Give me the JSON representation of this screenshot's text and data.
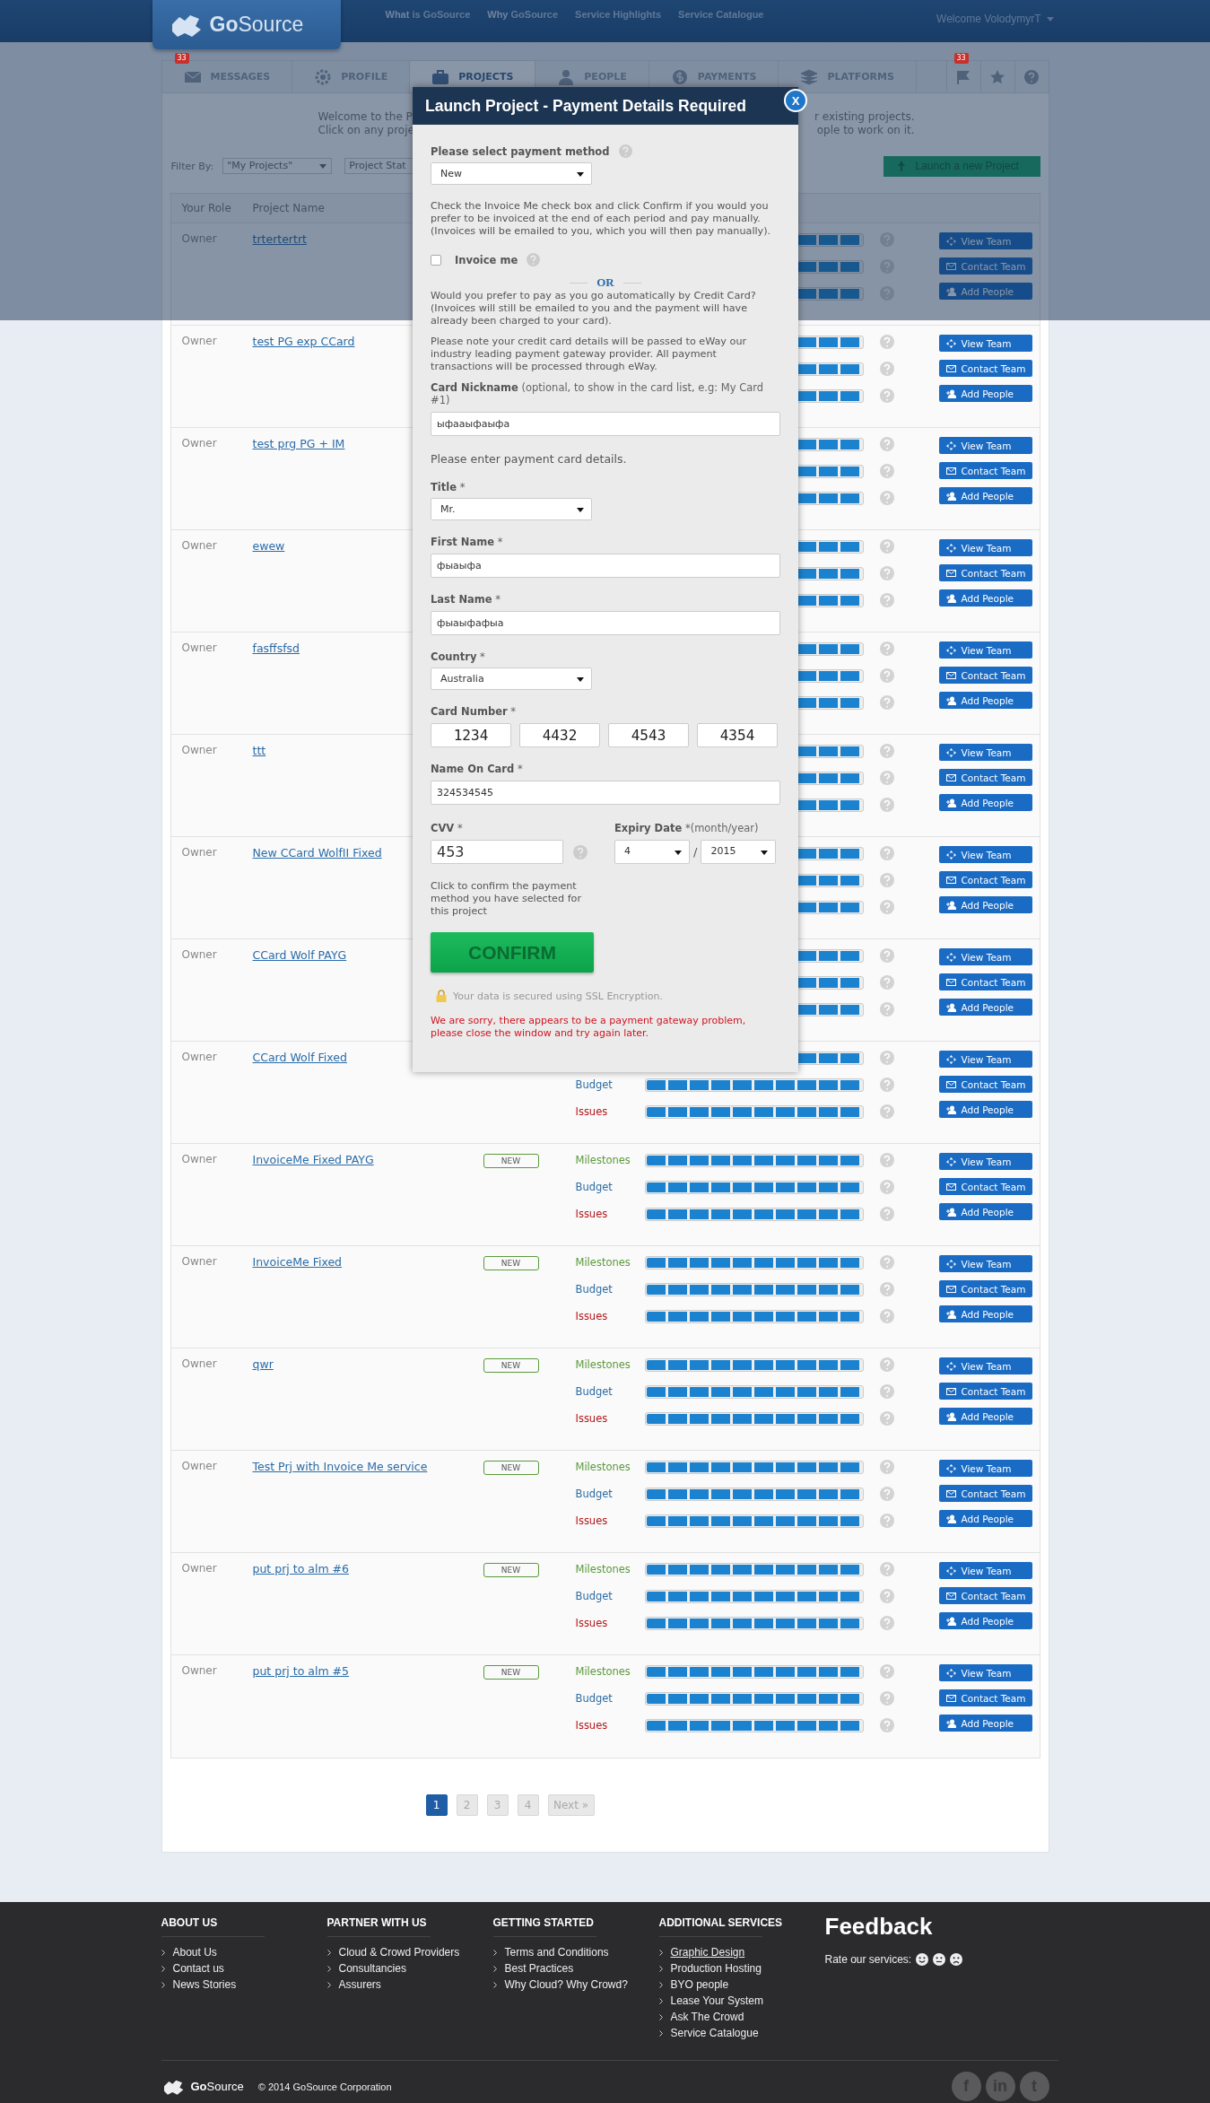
{
  "header": {
    "logo": "**Go**Source",
    "nav": [
      "**What** is GoSource",
      "**Why** GoSource",
      "Service Highlights",
      "Service Catalogue"
    ],
    "user": "Welcome VolodymyrT"
  },
  "tabs": [
    {
      "label": "MESSAGES",
      "kind": "envelope",
      "badge": "33",
      "selected": false
    },
    {
      "label": "PROFILE",
      "kind": "gear",
      "selected": false
    },
    {
      "label": "PROJECTS",
      "kind": "briefcase",
      "selected": true
    },
    {
      "label": "PEOPLE",
      "kind": "person",
      "selected": false
    },
    {
      "label": "PAYMENTS",
      "kind": "coin",
      "selected": false
    },
    {
      "label": "PLATFORMS",
      "kind": "stack",
      "selected": false
    }
  ],
  "tab_icons": [
    {
      "kind": "flag",
      "badge": "33"
    },
    {
      "kind": "star"
    },
    {
      "kind": "help"
    }
  ],
  "intro": {
    "left": [
      "Welcome to the P",
      "Click on any proje"
    ],
    "right": [
      "r existing projects.",
      "ople to work on it."
    ]
  },
  "filter": {
    "label": "Filter By:",
    "selects": [
      "\"My Projects\"",
      "Project Stat"
    ],
    "launch_button": "Launch a new Project"
  },
  "table": {
    "columns": [
      "Your Role",
      "Project Name"
    ],
    "rows": [
      {
        "role": "Owner",
        "name": "trtertertrt",
        "metrics": [
          {
            "kind": "milestones",
            "level": 1
          },
          {
            "kind": "budget",
            "level": 1
          },
          {
            "kind": "issues",
            "level": 1
          }
        ],
        "buttons": [
          {
            "kind": "view",
            "label": "View Team"
          },
          {
            "kind": "contact",
            "label": "Contact Team"
          },
          {
            "kind": "add",
            "label": "Add People"
          }
        ]
      },
      {
        "role": "Owner",
        "name": "test PG exp CCard",
        "metrics": [
          {
            "kind": "milestones",
            "level": 1
          },
          {
            "kind": "budget",
            "level": 1
          },
          {
            "kind": "issues",
            "level": 1
          }
        ],
        "buttons": [
          {
            "kind": "view",
            "label": "View Team"
          },
          {
            "kind": "contact",
            "label": "Contact Team"
          },
          {
            "kind": "add",
            "label": "Add People"
          }
        ]
      },
      {
        "role": "Owner",
        "name": "test prg PG + IM",
        "metrics": [
          {
            "kind": "milestones",
            "level": 1
          },
          {
            "kind": "budget",
            "level": 1
          },
          {
            "kind": "issues",
            "level": 1
          }
        ],
        "buttons": [
          {
            "kind": "view",
            "label": "View Team"
          },
          {
            "kind": "contact",
            "label": "Contact Team"
          },
          {
            "kind": "add",
            "label": "Add People"
          }
        ]
      },
      {
        "role": "Owner",
        "name": "ewew",
        "metrics": [
          {
            "kind": "milestones",
            "level": 1
          },
          {
            "kind": "budget",
            "level": 1
          },
          {
            "kind": "issues",
            "level": 1
          }
        ],
        "buttons": [
          {
            "kind": "view",
            "label": "View Team"
          },
          {
            "kind": "contact",
            "label": "Contact Team"
          },
          {
            "kind": "add",
            "label": "Add People"
          }
        ]
      },
      {
        "role": "Owner",
        "name": "fasffsfsd",
        "metrics": [
          {
            "kind": "milestones",
            "level": 1
          },
          {
            "kind": "budget",
            "level": 1
          },
          {
            "kind": "issues",
            "level": 1
          }
        ],
        "buttons": [
          {
            "kind": "view",
            "label": "View Team"
          },
          {
            "kind": "contact",
            "label": "Contact Team"
          },
          {
            "kind": "add",
            "label": "Add People"
          }
        ]
      },
      {
        "role": "Owner",
        "name": "ttt",
        "metrics": [
          {
            "kind": "milestones",
            "level": 1
          },
          {
            "kind": "budget",
            "level": 1
          },
          {
            "kind": "issues",
            "level": 1
          }
        ],
        "buttons": [
          {
            "kind": "view",
            "label": "View Team"
          },
          {
            "kind": "contact",
            "label": "Contact Team"
          },
          {
            "kind": "add",
            "label": "Add People"
          }
        ]
      },
      {
        "role": "Owner",
        "name": "New CCard WolfII Fixed",
        "metrics": [
          {
            "kind": "milestones",
            "level": 1
          },
          {
            "kind": "budget",
            "level": 1
          },
          {
            "kind": "issues",
            "level": 1
          }
        ],
        "buttons": [
          {
            "kind": "view",
            "label": "View Team"
          },
          {
            "kind": "contact",
            "label": "Contact Team"
          },
          {
            "kind": "add",
            "label": "Add People"
          }
        ]
      },
      {
        "role": "Owner",
        "name": "CCard Wolf PAYG",
        "metrics": [
          {
            "kind": "milestones",
            "level": 1
          },
          {
            "kind": "budget",
            "level": 1
          },
          {
            "kind": "issues",
            "level": 1
          }
        ],
        "buttons": [
          {
            "kind": "view",
            "label": "View Team"
          },
          {
            "kind": "contact",
            "label": "Contact Team"
          },
          {
            "kind": "add",
            "label": "Add People"
          }
        ]
      },
      {
        "role": "Owner",
        "name": "CCard Wolf Fixed",
        "metrics": [
          {
            "kind": "milestones",
            "level": 1
          },
          {
            "kind": "budget",
            "label": "Budget",
            "level": 1
          },
          {
            "kind": "issues",
            "label": "Issues",
            "level": 1
          }
        ],
        "buttons": [
          {
            "kind": "view",
            "label": "View Team"
          },
          {
            "kind": "contact",
            "label": "Contact Team"
          },
          {
            "kind": "add",
            "label": "Add People"
          }
        ]
      },
      {
        "role": "Owner",
        "name": "InvoiceMe Fixed PAYG",
        "badge": "NEW",
        "metrics": [
          {
            "kind": "milestones",
            "label": "Milestones",
            "level": 1
          },
          {
            "kind": "budget",
            "label": "Budget",
            "level": 1
          },
          {
            "kind": "issues",
            "label": "Issues",
            "level": 1
          }
        ],
        "buttons": [
          {
            "kind": "view",
            "label": "View Team"
          },
          {
            "kind": "contact",
            "label": "Contact Team"
          },
          {
            "kind": "add",
            "label": "Add People"
          }
        ]
      },
      {
        "role": "Owner",
        "name": "InvoiceMe Fixed",
        "badge": "NEW",
        "metrics": [
          {
            "kind": "milestones",
            "label": "Milestones",
            "level": 1
          },
          {
            "kind": "budget",
            "label": "Budget",
            "level": 1
          },
          {
            "kind": "issues",
            "label": "Issues",
            "level": 1
          }
        ],
        "buttons": [
          {
            "kind": "view",
            "label": "View Team"
          },
          {
            "kind": "contact",
            "label": "Contact Team"
          },
          {
            "kind": "add",
            "label": "Add People"
          }
        ]
      },
      {
        "role": "Owner",
        "name": "qwr",
        "badge": "NEW",
        "metrics": [
          {
            "kind": "milestones",
            "label": "Milestones",
            "level": 1
          },
          {
            "kind": "budget",
            "label": "Budget",
            "level": 1
          },
          {
            "kind": "issues",
            "label": "Issues",
            "level": 1
          }
        ],
        "buttons": [
          {
            "kind": "view",
            "label": "View Team"
          },
          {
            "kind": "contact",
            "label": "Contact Team"
          },
          {
            "kind": "add",
            "label": "Add People"
          }
        ]
      },
      {
        "role": "Owner",
        "name": "Test Prj with Invoice Me service",
        "badge": "NEW",
        "metrics": [
          {
            "kind": "milestones",
            "label": "Milestones",
            "level": 1
          },
          {
            "kind": "budget",
            "label": "Budget",
            "level": 1
          },
          {
            "kind": "issues",
            "label": "Issues",
            "level": 1
          }
        ],
        "buttons": [
          {
            "kind": "view",
            "label": "View Team"
          },
          {
            "kind": "contact",
            "label": "Contact Team"
          },
          {
            "kind": "add",
            "label": "Add People"
          }
        ]
      },
      {
        "role": "Owner",
        "name": "put prj to alm #6",
        "badge": "NEW",
        "metrics": [
          {
            "kind": "milestones",
            "label": "Milestones",
            "level": 1
          },
          {
            "kind": "budget",
            "label": "Budget",
            "level": 1
          },
          {
            "kind": "issues",
            "label": "Issues",
            "level": 1
          }
        ],
        "buttons": [
          {
            "kind": "view",
            "label": "View Team"
          },
          {
            "kind": "contact",
            "label": "Contact Team"
          },
          {
            "kind": "add",
            "label": "Add People"
          }
        ]
      },
      {
        "role": "Owner",
        "name": "put prj to alm #5",
        "badge": "NEW",
        "metrics": [
          {
            "kind": "milestones",
            "label": "Milestones",
            "level": 1
          },
          {
            "kind": "budget",
            "label": "Budget",
            "level": 1
          },
          {
            "kind": "issues",
            "label": "Issues",
            "level": 1
          }
        ],
        "buttons": [
          {
            "kind": "view",
            "label": "View Team"
          },
          {
            "kind": "contact",
            "label": "Contact Team"
          },
          {
            "kind": "add",
            "label": "Add People"
          }
        ]
      }
    ]
  },
  "pagination": {
    "pages": [
      {
        "label": "1",
        "selected": true
      },
      {
        "label": "2",
        "selected": false
      },
      {
        "label": "3",
        "selected": false
      },
      {
        "label": "4",
        "selected": false
      }
    ],
    "next": "Next »"
  },
  "modal": {
    "title": "Launch Project - Payment Details Required",
    "close": "X",
    "payment_method": {
      "label": "Please select payment method",
      "value": "New"
    },
    "invoice_note": "Check the Invoice Me check box and click Confirm if you would you prefer to be invoiced at the end of each period and pay manually. (Invoices will be emailed to you, which you will then pay manually).",
    "invoice_me": {
      "label": "Invoice me",
      "checked": false
    },
    "or_label": "OR",
    "card_note": "Would you prefer to pay as you go automatically by Credit Card? (Invoices will still be emailed to you and the payment will have already been charged to your card).",
    "gateway_note": "Please note your credit card details will be passed to eWay our industry leading payment gateway provider. All payment transactions will be processed through eWay.",
    "nickname": {
      "label": "**Card Nickname** (optional, to show in the card list, e.g: My Card #1)",
      "value": "ыфааыфаыфа"
    },
    "enter_details": "Please enter payment card details.",
    "fields": [
      {
        "kind": "select",
        "label": "**Title** *",
        "value": "Mr."
      },
      {
        "kind": "input",
        "label": "**First Name** *",
        "value": "фыаыфа"
      },
      {
        "kind": "input",
        "label": "**Last Name** *",
        "value": "фыаыфафыа"
      },
      {
        "kind": "select",
        "label": "**Country** *",
        "value": "Australia"
      },
      {
        "kind": "card_number",
        "label": "**Card Number** *",
        "parts": [
          "1234",
          "4432",
          "4543",
          "4354"
        ]
      },
      {
        "kind": "input",
        "label": "**Name On Card** *",
        "value": "324534545"
      }
    ],
    "cvv": {
      "label": "**CVV** *",
      "value": "453"
    },
    "expiry": {
      "label": "**Expiry Date** *(month/year)",
      "month": "4",
      "separator": "/",
      "year": "2015"
    },
    "confirm_note": "Click to confirm the payment method you have selected for this project",
    "confirm_button": "CONFIRM",
    "ssl_note": "Your data is secured using SSL Encryption.",
    "error": "We are sorry, there appears to be a payment gateway problem, please close the window and try again later."
  },
  "footer": {
    "columns": [
      {
        "heading": "ABOUT US",
        "links": [
          {
            "label": "About Us",
            "underlined": false
          },
          {
            "label": "Contact us",
            "underlined": false
          },
          {
            "label": "News Stories",
            "underlined": false
          }
        ]
      },
      {
        "heading": "PARTNER WITH US",
        "links": [
          {
            "label": "Cloud & Crowd Providers",
            "underlined": false
          },
          {
            "label": "Consultancies",
            "underlined": false
          },
          {
            "label": "Assurers",
            "underlined": false
          }
        ]
      },
      {
        "heading": "GETTING STARTED",
        "links": [
          {
            "label": "Terms and Conditions",
            "underlined": false
          },
          {
            "label": "Best Practices",
            "underlined": false
          },
          {
            "label": "Why Cloud? Why Crowd?",
            "underlined": false
          }
        ]
      },
      {
        "heading": "ADDITIONAL SERVICES",
        "links": [
          {
            "label": "Graphic Design",
            "underlined": true
          },
          {
            "label": "Production Hosting",
            "underlined": false
          },
          {
            "label": "BYO people",
            "underlined": false
          },
          {
            "label": "Lease Your System",
            "underlined": false
          },
          {
            "label": "Ask The Crowd",
            "underlined": false
          },
          {
            "label": "Service Catalogue",
            "underlined": false
          }
        ]
      }
    ],
    "feedback": {
      "title": "Feedback",
      "rate_label": "Rate our services:",
      "faces": [
        {
          "kind": "happy"
        },
        {
          "kind": "neutral"
        },
        {
          "kind": "sad"
        }
      ]
    },
    "logo": "**Go**Source",
    "copyright": "© 2014 GoSource Corporation",
    "social": [
      "f",
      "in",
      "t"
    ]
  }
}
